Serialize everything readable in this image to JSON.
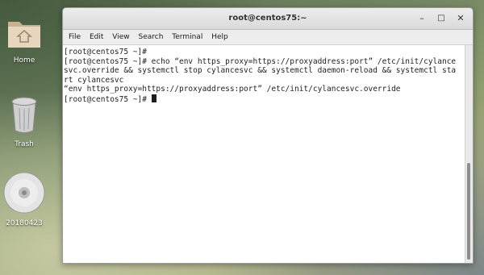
{
  "desktop": {
    "icons": [
      {
        "label": "Home",
        "icon": "folder-home-icon"
      },
      {
        "label": "Trash",
        "icon": "trash-icon"
      },
      {
        "label": "20180423",
        "icon": "optical-disc-icon"
      }
    ]
  },
  "window": {
    "title": "root@centos75:~",
    "buttons": {
      "minimize": "–",
      "maximize": "□",
      "close": "✕"
    },
    "menu": [
      "File",
      "Edit",
      "View",
      "Search",
      "Terminal",
      "Help"
    ],
    "terminal_lines": [
      "[root@centos75 ~]#",
      "[root@centos75 ~]# echo “env https_proxy=https://proxyaddress:port” /etc/init/cylance",
      "svc.override && systemctl stop cylancesvc && systemctl daemon-reload && systemctl sta",
      "rt cylancesvc",
      "“env https_proxy=https://proxyaddress:port” /etc/init/cylancesvc.override",
      "[root@centos75 ~]# "
    ]
  }
}
